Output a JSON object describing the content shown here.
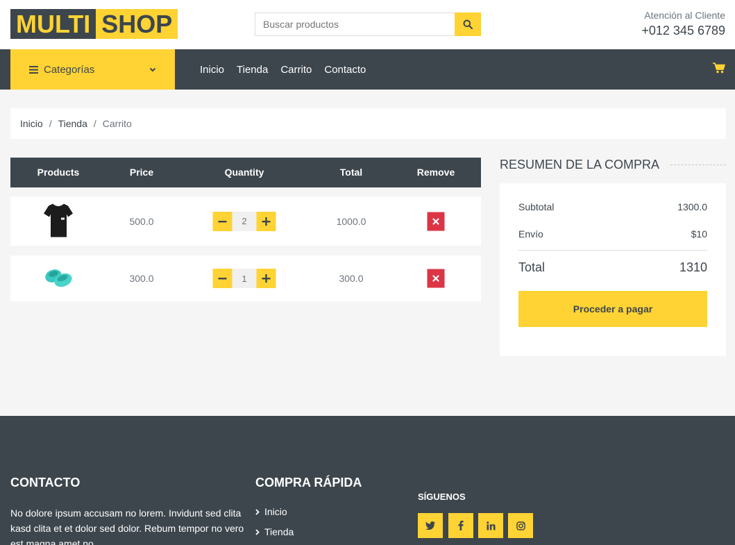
{
  "brand": {
    "part1": "MULTI",
    "part2": "SHOP"
  },
  "search": {
    "placeholder": "Buscar productos"
  },
  "contact_header": {
    "label": "Atención al Cliente",
    "phone": "+012 345 6789"
  },
  "nav": {
    "categories_label": "Categorías",
    "links": [
      "Inicio",
      "Tienda",
      "Carrito",
      "Contacto"
    ]
  },
  "breadcrumb": [
    "Inicio",
    "Tienda",
    "Carrito"
  ],
  "cart": {
    "headers": [
      "Products",
      "Price",
      "Quantity",
      "Total",
      "Remove"
    ],
    "rows": [
      {
        "product_image": "black t-shirt",
        "price": "500.0",
        "quantity": "2",
        "total": "1000.0"
      },
      {
        "product_image": "teal slide sandals",
        "price": "300.0",
        "quantity": "1",
        "total": "300.0"
      }
    ]
  },
  "summary": {
    "title": "RESUMEN DE LA COMPRA",
    "subtotal_label": "Subtotal",
    "subtotal_value": "1300.0",
    "shipping_label": "Envío",
    "shipping_value": "$10",
    "total_label": "Total",
    "total_value": "1310",
    "checkout_label": "Proceder a pagar"
  },
  "footer": {
    "contact_title": "CONTACTO",
    "contact_text": "No dolore ipsum accusam no lorem. Invidunt sed clita kasd clita et et dolor sed dolor. Rebum tempor no vero est magna amet no",
    "quick_title": "COMPRA RÁPIDA",
    "quick_links": [
      "Inicio",
      "Tienda"
    ],
    "follow_title": "SÍGUENOS",
    "social_icons": [
      "twitter-icon",
      "facebook-icon",
      "linkedin-icon",
      "instagram-icon"
    ]
  },
  "colors": {
    "accent": "#ffd333",
    "dark": "#3d464d",
    "danger": "#dc3545"
  }
}
